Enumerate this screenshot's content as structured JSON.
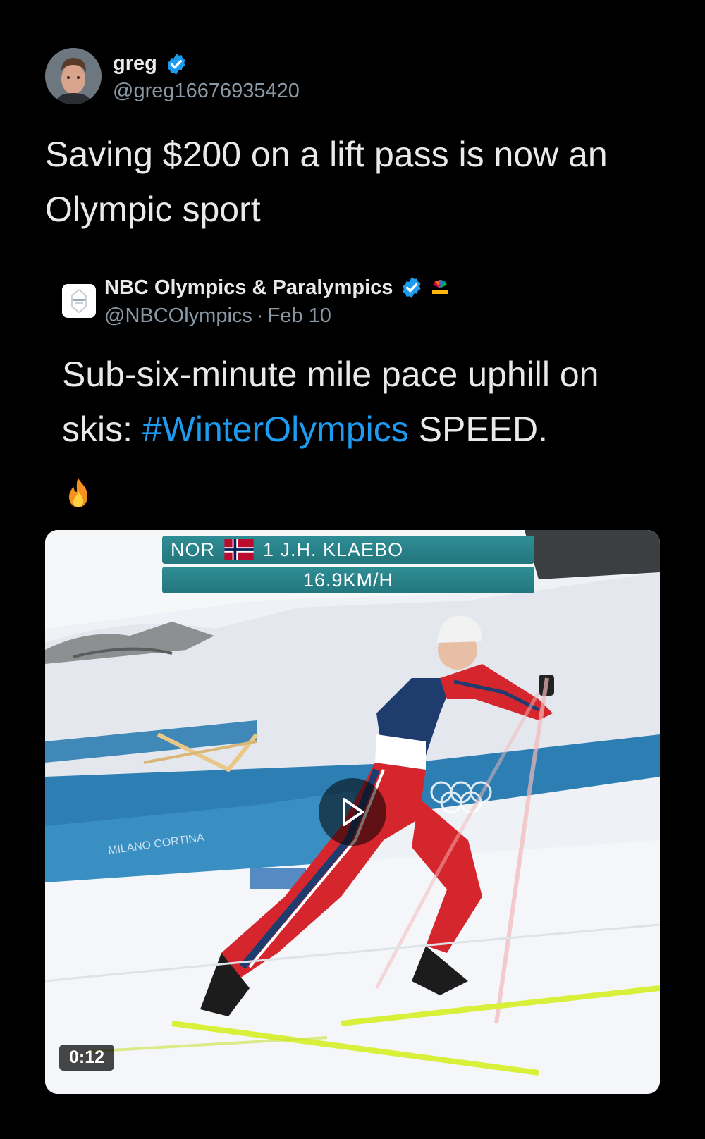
{
  "tweet": {
    "author": {
      "display_name": "greg",
      "handle": "@greg16676935420",
      "verified": true
    },
    "text": "Saving $200 on a lift pass is now an Olympic sport"
  },
  "quoted": {
    "author": {
      "display_name": "NBC Olympics & Paralympics",
      "handle": "@NBCOlympics",
      "verified": true,
      "affiliate_badge": "nbc-peacock-icon"
    },
    "separator": "·",
    "date": "Feb 10",
    "text_before": "Sub-six-minute mile pace uphill on skis: ",
    "hashtag": "#WinterOlympics",
    "text_after": " SPEED.",
    "emoji": "fire-icon",
    "video": {
      "overlay": {
        "country": "NOR",
        "athlete": "1 J.H. KLAEBO",
        "speed": "16.9KM/H"
      },
      "duration": "0:12",
      "play_icon": "play-icon"
    }
  },
  "colors": {
    "background": "#000000",
    "text": "#e7e9ea",
    "secondary": "#8b98a5",
    "link": "#1d9bf0",
    "verified": "#1d9bf0",
    "overlay_teal": "#2a8188"
  }
}
